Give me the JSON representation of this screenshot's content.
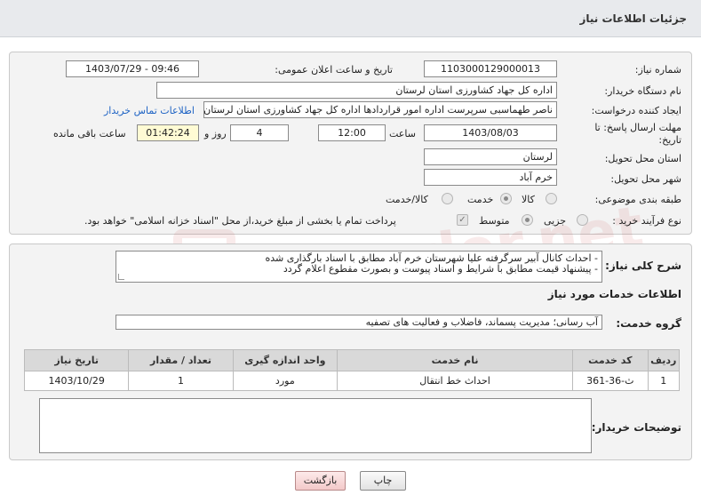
{
  "header": {
    "title": "جزئیات اطلاعات نیاز"
  },
  "form": {
    "need_number_label": "شماره نیاز:",
    "need_number": "1103000129000013",
    "announce_label": "تاریخ و ساعت اعلان عمومی:",
    "announce_value": "1403/07/29 - 09:46",
    "buyer_org_label": "نام دستگاه خریدار:",
    "buyer_org": "اداره کل جهاد کشاورزی استان لرستان",
    "creator_label": "ایجاد کننده درخواست:",
    "creator": "ناصر طهماسبی سرپرست اداره امور قراردادها اداره کل جهاد کشاورزی استان لرستان",
    "contact_link": "اطلاعات تماس خریدار",
    "deadline_label": "مهلت ارسال پاسخ: تا تاریخ:",
    "deadline_date": "1403/08/03",
    "time_label": "ساعت",
    "deadline_time": "12:00",
    "days_value": "4",
    "days_label": "روز و",
    "remaining_time": "01:42:24",
    "remaining_label": "ساعت باقی مانده",
    "province_label": "استان محل تحویل:",
    "province": "لرستان",
    "city_label": "شهر محل تحویل:",
    "city": "خرم آباد",
    "category_label": "طبقه بندی موضوعی:",
    "category_options": [
      "کالا",
      "خدمت",
      "کالا/خدمت"
    ],
    "purchase_type_label": "نوع فرآیند خرید :",
    "purchase_options": [
      "جزیی",
      "متوسط"
    ],
    "payment_note": "پرداخت تمام یا بخشی از مبلغ خرید،از محل \"اسناد خزانه اسلامی\" خواهد بود."
  },
  "description": {
    "label": "شرح کلی نیاز:",
    "lines": [
      "- احداث کانال آبیر سرگرفته علیا شهرستان خرم آباد مطابق با اسناد بارگذاری شده",
      "- پیشنهاد قیمت مطابق با شرایط و اسناد پیوست و بصورت مقطوع اعلام گردد"
    ]
  },
  "services": {
    "section_title": "اطلاعات خدمات مورد نیاز",
    "group_label": "گروه خدمت:",
    "group_value": "آب رسانی؛ مدیریت پسماند، فاضلاب و فعالیت های تصفیه",
    "columns": [
      "ردیف",
      "کد خدمت",
      "نام خدمت",
      "واحد اندازه گیری",
      "تعداد / مقدار",
      "تاریخ نیاز"
    ],
    "rows": [
      [
        "1",
        "ث-36-361",
        "احداث خط انتقال",
        "مورد",
        "1",
        "1403/10/29"
      ]
    ]
  },
  "buyer_notes": {
    "label": "توضیحات خریدار:",
    "value": ""
  },
  "buttons": {
    "print": "چاپ",
    "back": "بازگشت"
  },
  "watermark": "AriaTender.net"
}
